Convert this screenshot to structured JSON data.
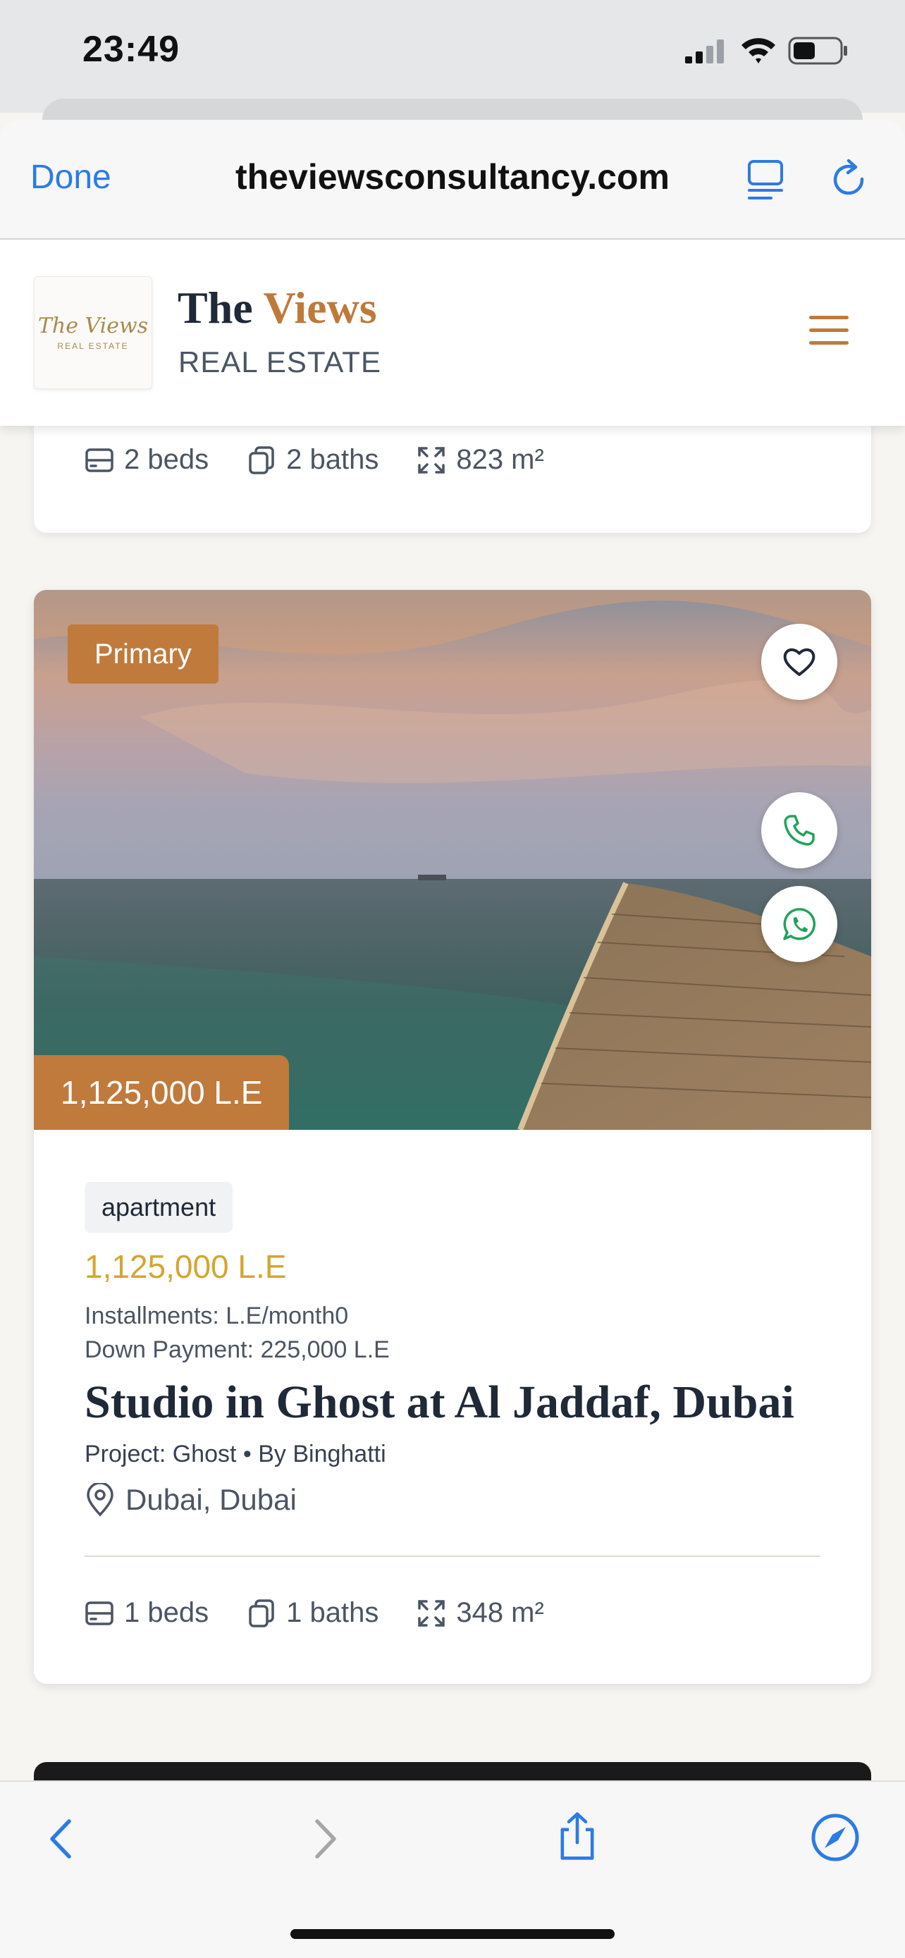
{
  "status_bar": {
    "time": "23:49",
    "icons": [
      "signal-icon",
      "wifi-icon",
      "battery-icon"
    ]
  },
  "browser": {
    "done_label": "Done",
    "url": "theviewsconsultancy.com",
    "icons": [
      "reader-icon",
      "reload-icon"
    ]
  },
  "site": {
    "logo_script": "The Views",
    "logo_small": "REAL ESTATE",
    "brand_the": "The ",
    "brand_views": "Views",
    "brand_sub": "REAL ESTATE",
    "accent_color": "#bf7a3a"
  },
  "prev_card": {
    "beds": "2 beds",
    "baths": "2 baths",
    "area": "823 m²"
  },
  "card": {
    "badge": "Primary",
    "price_overlay": "1,125,000 L.E",
    "type": "apartment",
    "price": "1,125,000 L.E",
    "installments": "Installments: L.E/month0",
    "down_payment": "Down Payment: 225,000 L.E",
    "title": "Studio in Ghost at Al Jaddaf, Dubai",
    "project": "Project: Ghost • By Binghatti",
    "location": "Dubai, Dubai",
    "beds": "1 beds",
    "baths": "1 baths",
    "area": "348 m²",
    "price_color": "#d4a531"
  },
  "toolbar": {
    "icons": [
      "back-icon",
      "forward-icon",
      "share-icon",
      "compass-icon"
    ]
  }
}
